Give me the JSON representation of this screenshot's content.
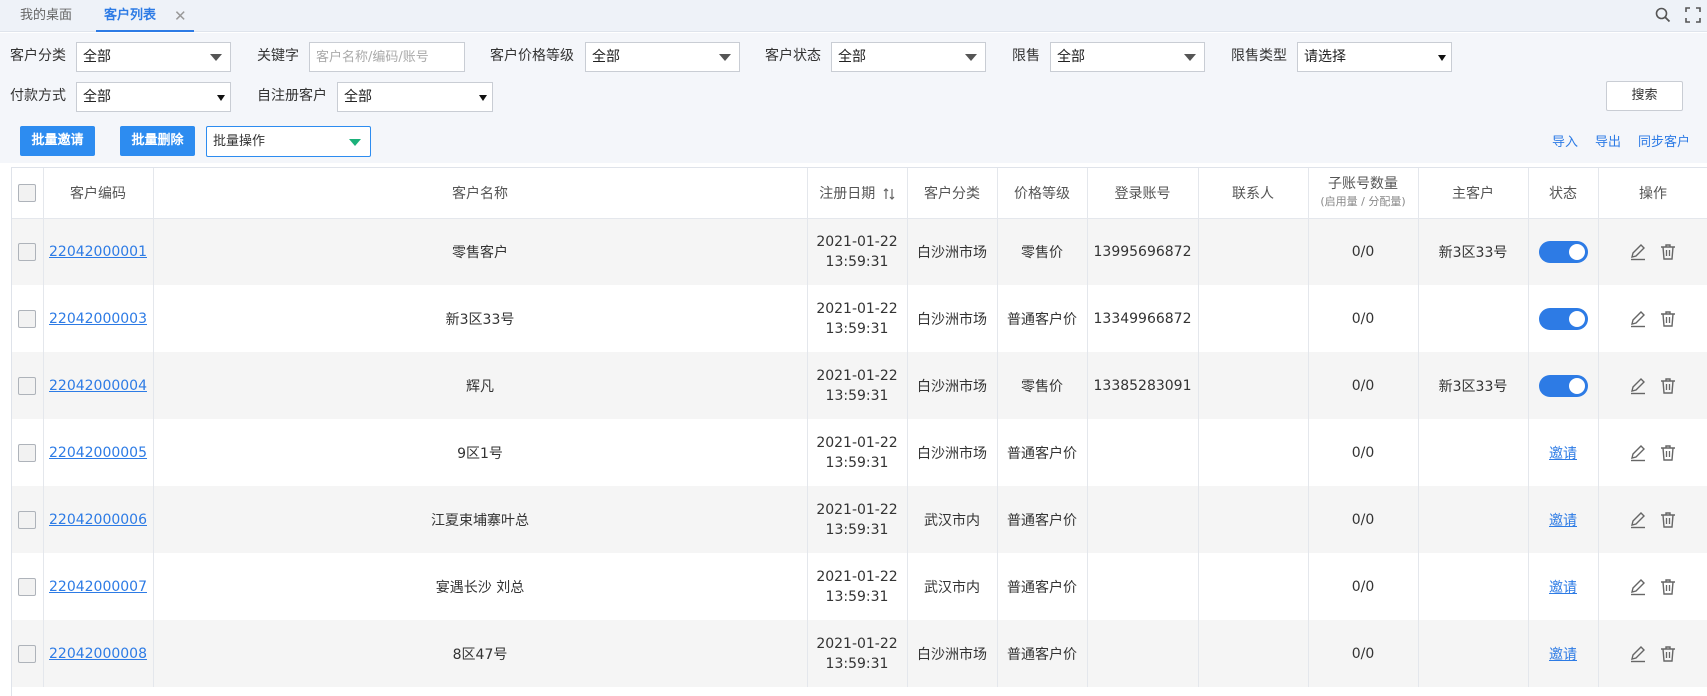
{
  "tabs": [
    {
      "label": "我的桌面",
      "active": false
    },
    {
      "label": "客户列表",
      "active": true
    }
  ],
  "filters": {
    "category_label": "客户分类",
    "category_value": "全部",
    "keyword_label": "关键字",
    "keyword_placeholder": "客户名称/编码/账号",
    "price_level_label": "客户价格等级",
    "price_level_value": "全部",
    "status_label": "客户状态",
    "status_value": "全部",
    "limit_label": "限售",
    "limit_value": "全部",
    "limit_type_label": "限售类型",
    "limit_type_value": "请选择",
    "payment_label": "付款方式",
    "payment_value": "全部",
    "self_reg_label": "自注册客户",
    "self_reg_value": "全部",
    "search_label": "搜索"
  },
  "actions": {
    "batch_invite": "批量邀请",
    "batch_delete": "批量删除",
    "batch_ops": "批量操作",
    "import": "导入",
    "export": "导出",
    "sync": "同步客户"
  },
  "table": {
    "headers": {
      "code": "客户编码",
      "name": "客户名称",
      "reg_date": "注册日期",
      "category": "客户分类",
      "price_level": "价格等级",
      "account": "登录账号",
      "contact": "联系人",
      "sub_count": "子账号数量",
      "sub_count_note": "(启用量 / 分配量)",
      "main": "主客户",
      "status": "状态",
      "ops": "操作"
    },
    "rows": [
      {
        "code": "22042000001",
        "name": "零售客户",
        "date": "2021-01-22",
        "time": "13:59:31",
        "category": "白沙洲市场",
        "price": "零售价",
        "account": "13995696872",
        "contact": "",
        "sub": "0/0",
        "main": "新3区33号",
        "status": "toggle"
      },
      {
        "code": "22042000003",
        "name": "新3区33号",
        "date": "2021-01-22",
        "time": "13:59:31",
        "category": "白沙洲市场",
        "price": "普通客户价",
        "account": "13349966872",
        "contact": "",
        "sub": "0/0",
        "main": "",
        "status": "toggle"
      },
      {
        "code": "22042000004",
        "name": "辉凡",
        "date": "2021-01-22",
        "time": "13:59:31",
        "category": "白沙洲市场",
        "price": "零售价",
        "account": "13385283091",
        "contact": "",
        "sub": "0/0",
        "main": "新3区33号",
        "status": "toggle"
      },
      {
        "code": "22042000005",
        "name": "9区1号",
        "date": "2021-01-22",
        "time": "13:59:31",
        "category": "白沙洲市场",
        "price": "普通客户价",
        "account": "",
        "contact": "",
        "sub": "0/0",
        "main": "",
        "status": "邀请"
      },
      {
        "code": "22042000006",
        "name": "江夏束埔寨叶总",
        "date": "2021-01-22",
        "time": "13:59:31",
        "category": "武汉市内",
        "price": "普通客户价",
        "account": "",
        "contact": "",
        "sub": "0/0",
        "main": "",
        "status": "邀请"
      },
      {
        "code": "22042000007",
        "name": "宴遇长沙 刘总",
        "date": "2021-01-22",
        "time": "13:59:31",
        "category": "武汉市内",
        "price": "普通客户价",
        "account": "",
        "contact": "",
        "sub": "0/0",
        "main": "",
        "status": "邀请"
      },
      {
        "code": "22042000008",
        "name": "8区47号",
        "date": "2021-01-22",
        "time": "13:59:31",
        "category": "白沙洲市场",
        "price": "普通客户价",
        "account": "",
        "contact": "",
        "sub": "0/0",
        "main": "",
        "status": "邀请"
      }
    ]
  },
  "icons": {
    "search": "search-icon",
    "fullscreen": "fullscreen-icon",
    "edit": "edit-icon",
    "delete": "trash-icon",
    "sort": "sort-icon"
  },
  "colors": {
    "primary": "#2d8cf0",
    "link": "#2d7be5",
    "dropdown_accent": "#1bb17a"
  }
}
